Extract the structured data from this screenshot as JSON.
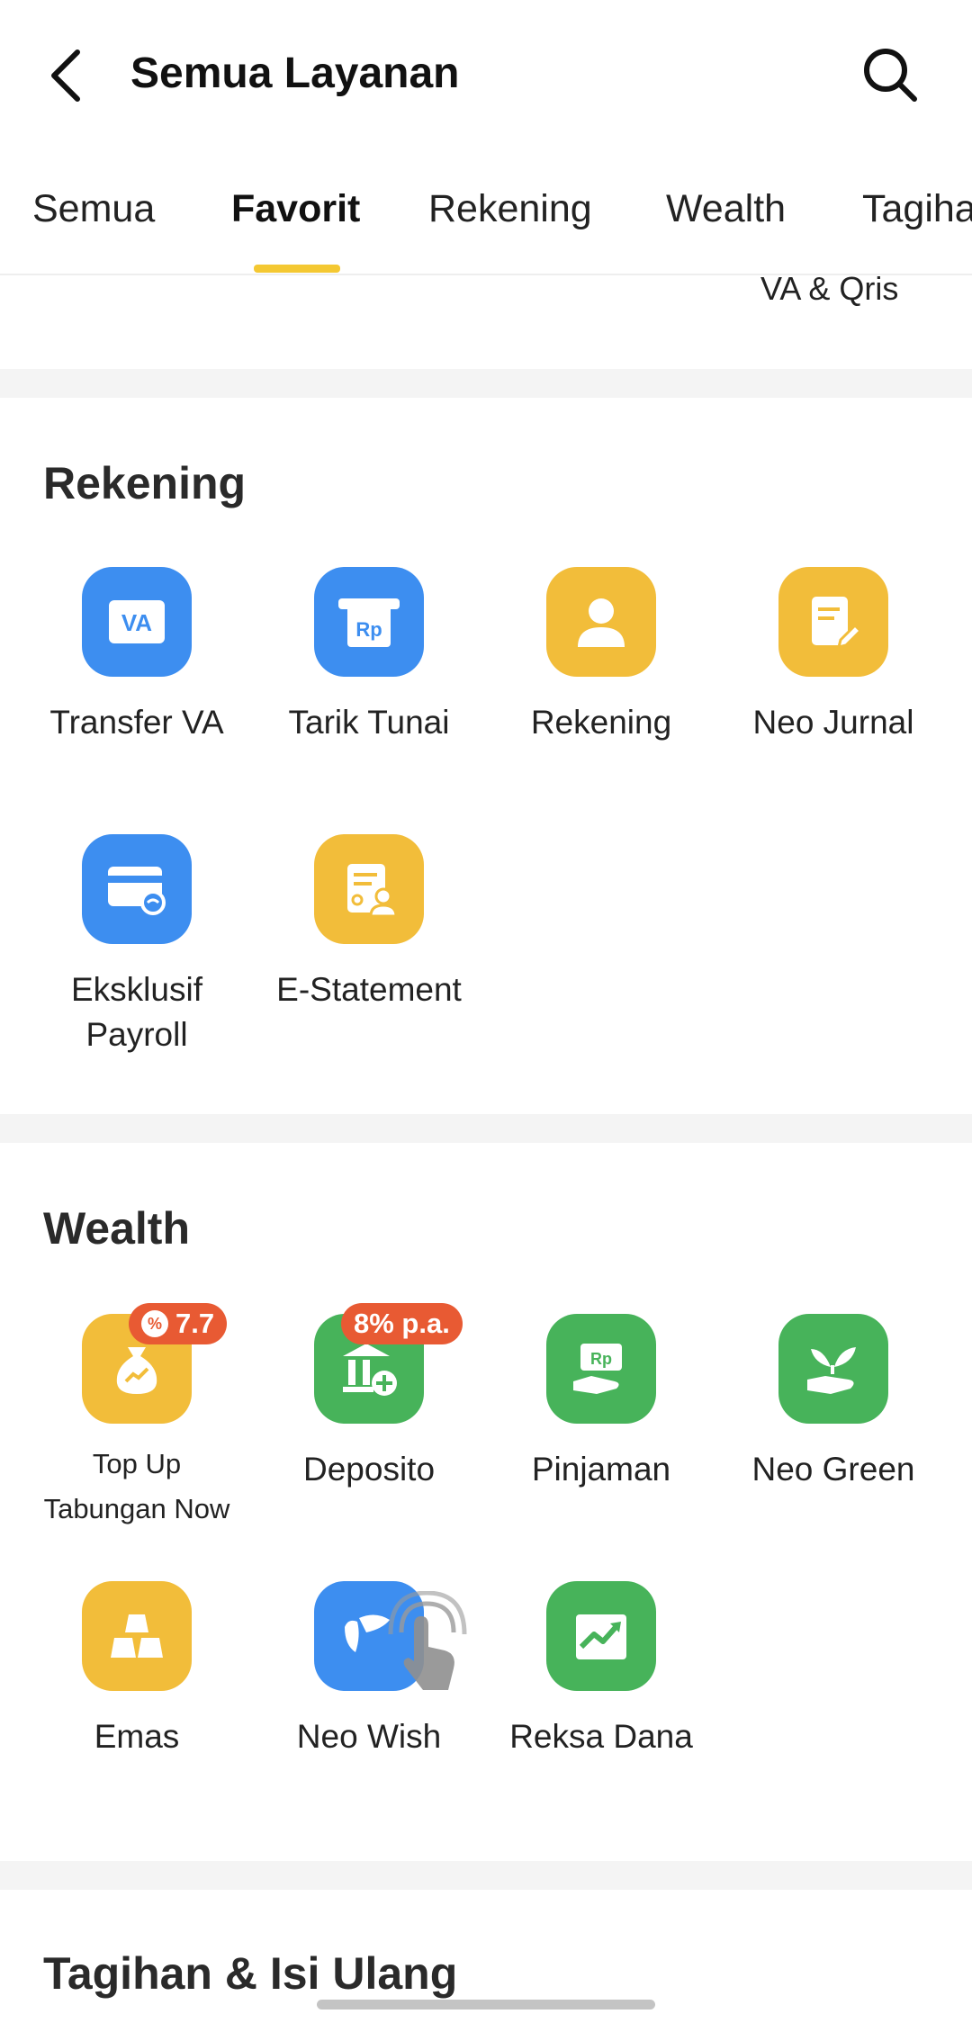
{
  "header": {
    "title": "Semua Layanan",
    "back_icon": "back-arrow-icon",
    "search_icon": "search-icon"
  },
  "tabs": [
    {
      "label": "Semua"
    },
    {
      "label": "Favorit",
      "active": true
    },
    {
      "label": "Rekening"
    },
    {
      "label": "Wealth"
    },
    {
      "label": "Tagihan"
    }
  ],
  "clipped_item_label": "VA & Qris",
  "rekening": {
    "title": "Rekening",
    "items": [
      {
        "label": "Transfer VA",
        "icon": "va-icon",
        "color": "#3d8ef0"
      },
      {
        "label": "Tarik Tunai",
        "icon": "atm-rp-icon",
        "color": "#3d8ef0"
      },
      {
        "label": "Rekening",
        "icon": "person-icon",
        "color": "#f2bd3a"
      },
      {
        "label": "Neo Jurnal",
        "icon": "note-edit-icon",
        "color": "#f2bd3a"
      },
      {
        "label_line1": "Eksklusif",
        "label_line2": "Payroll",
        "icon": "card-link-icon",
        "color": "#3d8ef0"
      },
      {
        "label": "E-Statement",
        "icon": "statement-icon",
        "color": "#f2bd3a"
      }
    ]
  },
  "wealth": {
    "title": "Wealth",
    "items": [
      {
        "label_line1": "Top Up",
        "label_line2": "Tabungan Now",
        "icon": "money-bag-icon",
        "color": "#f2bd3a",
        "badge": "7.7"
      },
      {
        "label": "Deposito",
        "icon": "bank-plus-icon",
        "color": "#47b35a",
        "badge": "8% p.a."
      },
      {
        "label": "Pinjaman",
        "icon": "loan-hand-icon",
        "color": "#47b35a"
      },
      {
        "label": "Neo Green",
        "icon": "sprout-hand-icon",
        "color": "#47b35a"
      },
      {
        "label": "Emas",
        "icon": "gold-bars-icon",
        "color": "#f2bd3a"
      },
      {
        "label": "Neo Wish",
        "icon": "wish-icon",
        "color": "#3d8ef0"
      },
      {
        "label": "Reksa Dana",
        "icon": "chart-up-icon",
        "color": "#47b35a"
      }
    ]
  },
  "tagihan": {
    "title": "Tagihan & Isi Ulang"
  }
}
